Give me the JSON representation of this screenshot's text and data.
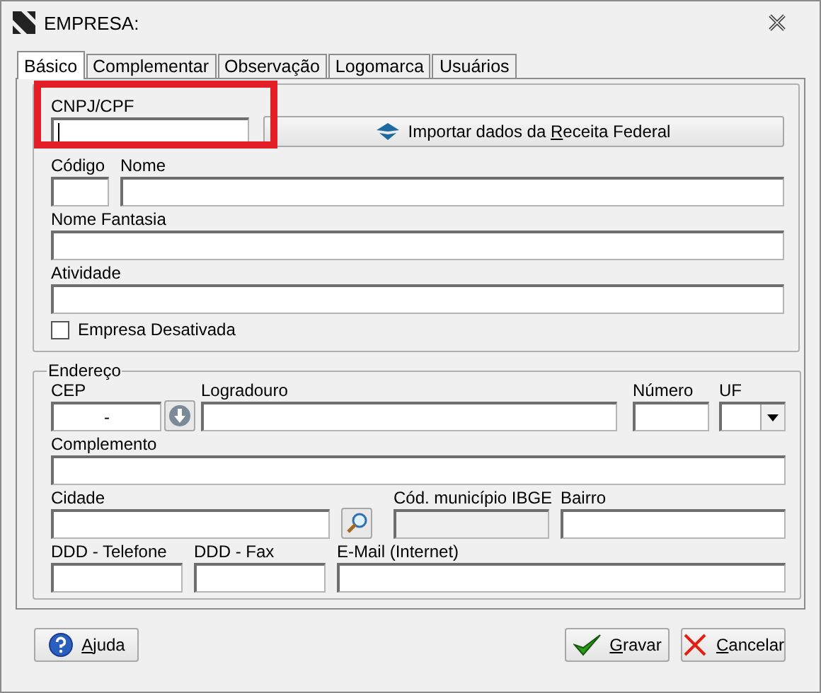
{
  "window": {
    "title": "EMPRESA:"
  },
  "tabs": [
    {
      "label": "Básico",
      "selected": true
    },
    {
      "label": "Complementar",
      "selected": false
    },
    {
      "label": "Observação",
      "selected": false
    },
    {
      "label": "Logomarca",
      "selected": false
    },
    {
      "label": "Usuários",
      "selected": false
    }
  ],
  "general": {
    "cnpj": {
      "label": "CNPJ/CPF",
      "focused": true
    },
    "import_button": {
      "pre": "Importar dados da ",
      "key": "R",
      "post": "eceita Federal"
    },
    "codigo": {
      "label": "Código"
    },
    "nome": {
      "label": "Nome"
    },
    "nome_fantasia": {
      "label": "Nome Fantasia"
    },
    "atividade": {
      "label": "Atividade"
    },
    "empresa_desativada": {
      "label": "Empresa Desativada",
      "checked": false
    }
  },
  "address": {
    "legend": "Endereço",
    "cep": {
      "label": "CEP",
      "value": "-"
    },
    "logradouro": {
      "label": "Logradouro"
    },
    "numero": {
      "label": "Número"
    },
    "uf": {
      "label": "UF"
    },
    "complemento": {
      "label": "Complemento"
    },
    "cidade": {
      "label": "Cidade"
    },
    "ibge": {
      "label": "Cód. município IBGE",
      "disabled": true
    },
    "bairro": {
      "label": "Bairro"
    },
    "telefone": {
      "label": "DDD - Telefone"
    },
    "fax": {
      "label": "DDD - Fax"
    },
    "email": {
      "label": "E-Mail (Internet)"
    }
  },
  "buttons": [
    {
      "kind": "help",
      "key": "A",
      "post": "juda"
    },
    {
      "kind": "save",
      "key": "G",
      "post": "ravar"
    },
    {
      "kind": "cancel",
      "key": "C",
      "post": "ancelar"
    }
  ]
}
